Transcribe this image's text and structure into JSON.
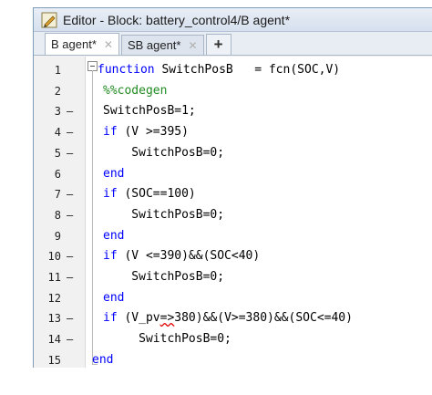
{
  "window": {
    "title": "Editor - Block: battery_control4/B agent*"
  },
  "tabs": [
    {
      "label": "B agent*",
      "close": "✕",
      "active": true
    },
    {
      "label": "SB agent*",
      "close": "✕",
      "active": false
    }
  ],
  "tab_add_label": "+",
  "lines": [
    {
      "num": "1",
      "mark": "",
      "parts": [
        {
          "t": "function ",
          "k": "kw"
        },
        {
          "t": "SwitchPosB   = fcn(SOC,V)"
        }
      ]
    },
    {
      "num": "2",
      "mark": "",
      "parts": [
        {
          "t": "%%codegen",
          "k": "cm"
        }
      ]
    },
    {
      "num": "3",
      "mark": "–",
      "parts": [
        {
          "t": "SwitchPosB=1;"
        }
      ]
    },
    {
      "num": "4",
      "mark": "–",
      "parts": [
        {
          "t": "if ",
          "k": "kw"
        },
        {
          "t": "(V >=395)"
        }
      ]
    },
    {
      "num": "5",
      "mark": "–",
      "parts": [
        {
          "t": "    SwitchPosB=0;"
        }
      ]
    },
    {
      "num": "6",
      "mark": "",
      "parts": [
        {
          "t": "end",
          "k": "kw"
        }
      ]
    },
    {
      "num": "7",
      "mark": "–",
      "parts": [
        {
          "t": "if ",
          "k": "kw"
        },
        {
          "t": "(SOC==100)"
        }
      ]
    },
    {
      "num": "8",
      "mark": "–",
      "parts": [
        {
          "t": "    SwitchPosB=0;"
        }
      ]
    },
    {
      "num": "9",
      "mark": "",
      "parts": [
        {
          "t": "end",
          "k": "kw"
        }
      ]
    },
    {
      "num": "10",
      "mark": "–",
      "parts": [
        {
          "t": "if ",
          "k": "kw"
        },
        {
          "t": "(V <=390)&&(SOC<40)"
        }
      ]
    },
    {
      "num": "11",
      "mark": "–",
      "parts": [
        {
          "t": "    SwitchPosB=0;"
        }
      ]
    },
    {
      "num": "12",
      "mark": "",
      "parts": [
        {
          "t": "end",
          "k": "kw"
        }
      ]
    },
    {
      "num": "13",
      "mark": "–",
      "parts": [
        {
          "t": "if ",
          "k": "kw"
        },
        {
          "t": "(V_pv"
        },
        {
          "t": "=>",
          "k": "squig"
        },
        {
          "t": "380)&&(V>=380)&&(SOC<=40)"
        }
      ]
    },
    {
      "num": "14",
      "mark": "–",
      "parts": [
        {
          "t": "     SwitchPosB=0;"
        }
      ]
    },
    {
      "num": "15",
      "mark": "",
      "parts": [
        {
          "t": "end",
          "k": "kw"
        }
      ]
    }
  ]
}
